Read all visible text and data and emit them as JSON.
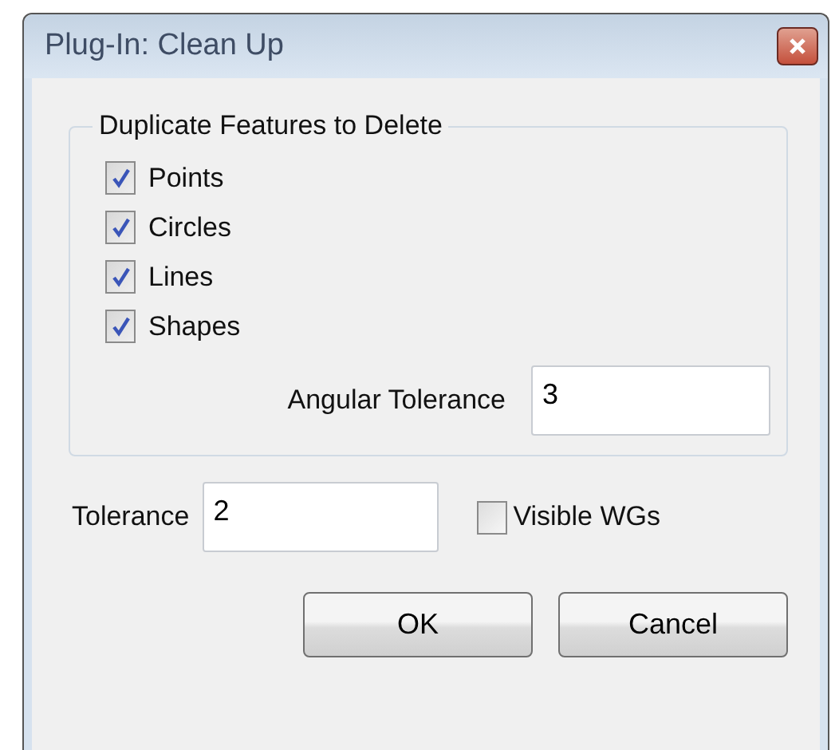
{
  "window": {
    "title": "Plug-In: Clean Up"
  },
  "group": {
    "title": "Duplicate Features to Delete",
    "options": [
      {
        "label": "Points",
        "checked": true
      },
      {
        "label": "Circles",
        "checked": true
      },
      {
        "label": "Lines",
        "checked": true
      },
      {
        "label": "Shapes",
        "checked": true
      }
    ],
    "angular_tolerance": {
      "label": "Angular Tolerance",
      "value": "3"
    }
  },
  "tolerance": {
    "label": "Tolerance",
    "value": "2"
  },
  "visible_wgs": {
    "label": "Visible WGs",
    "checked": false
  },
  "buttons": [
    "OK",
    "Cancel"
  ]
}
